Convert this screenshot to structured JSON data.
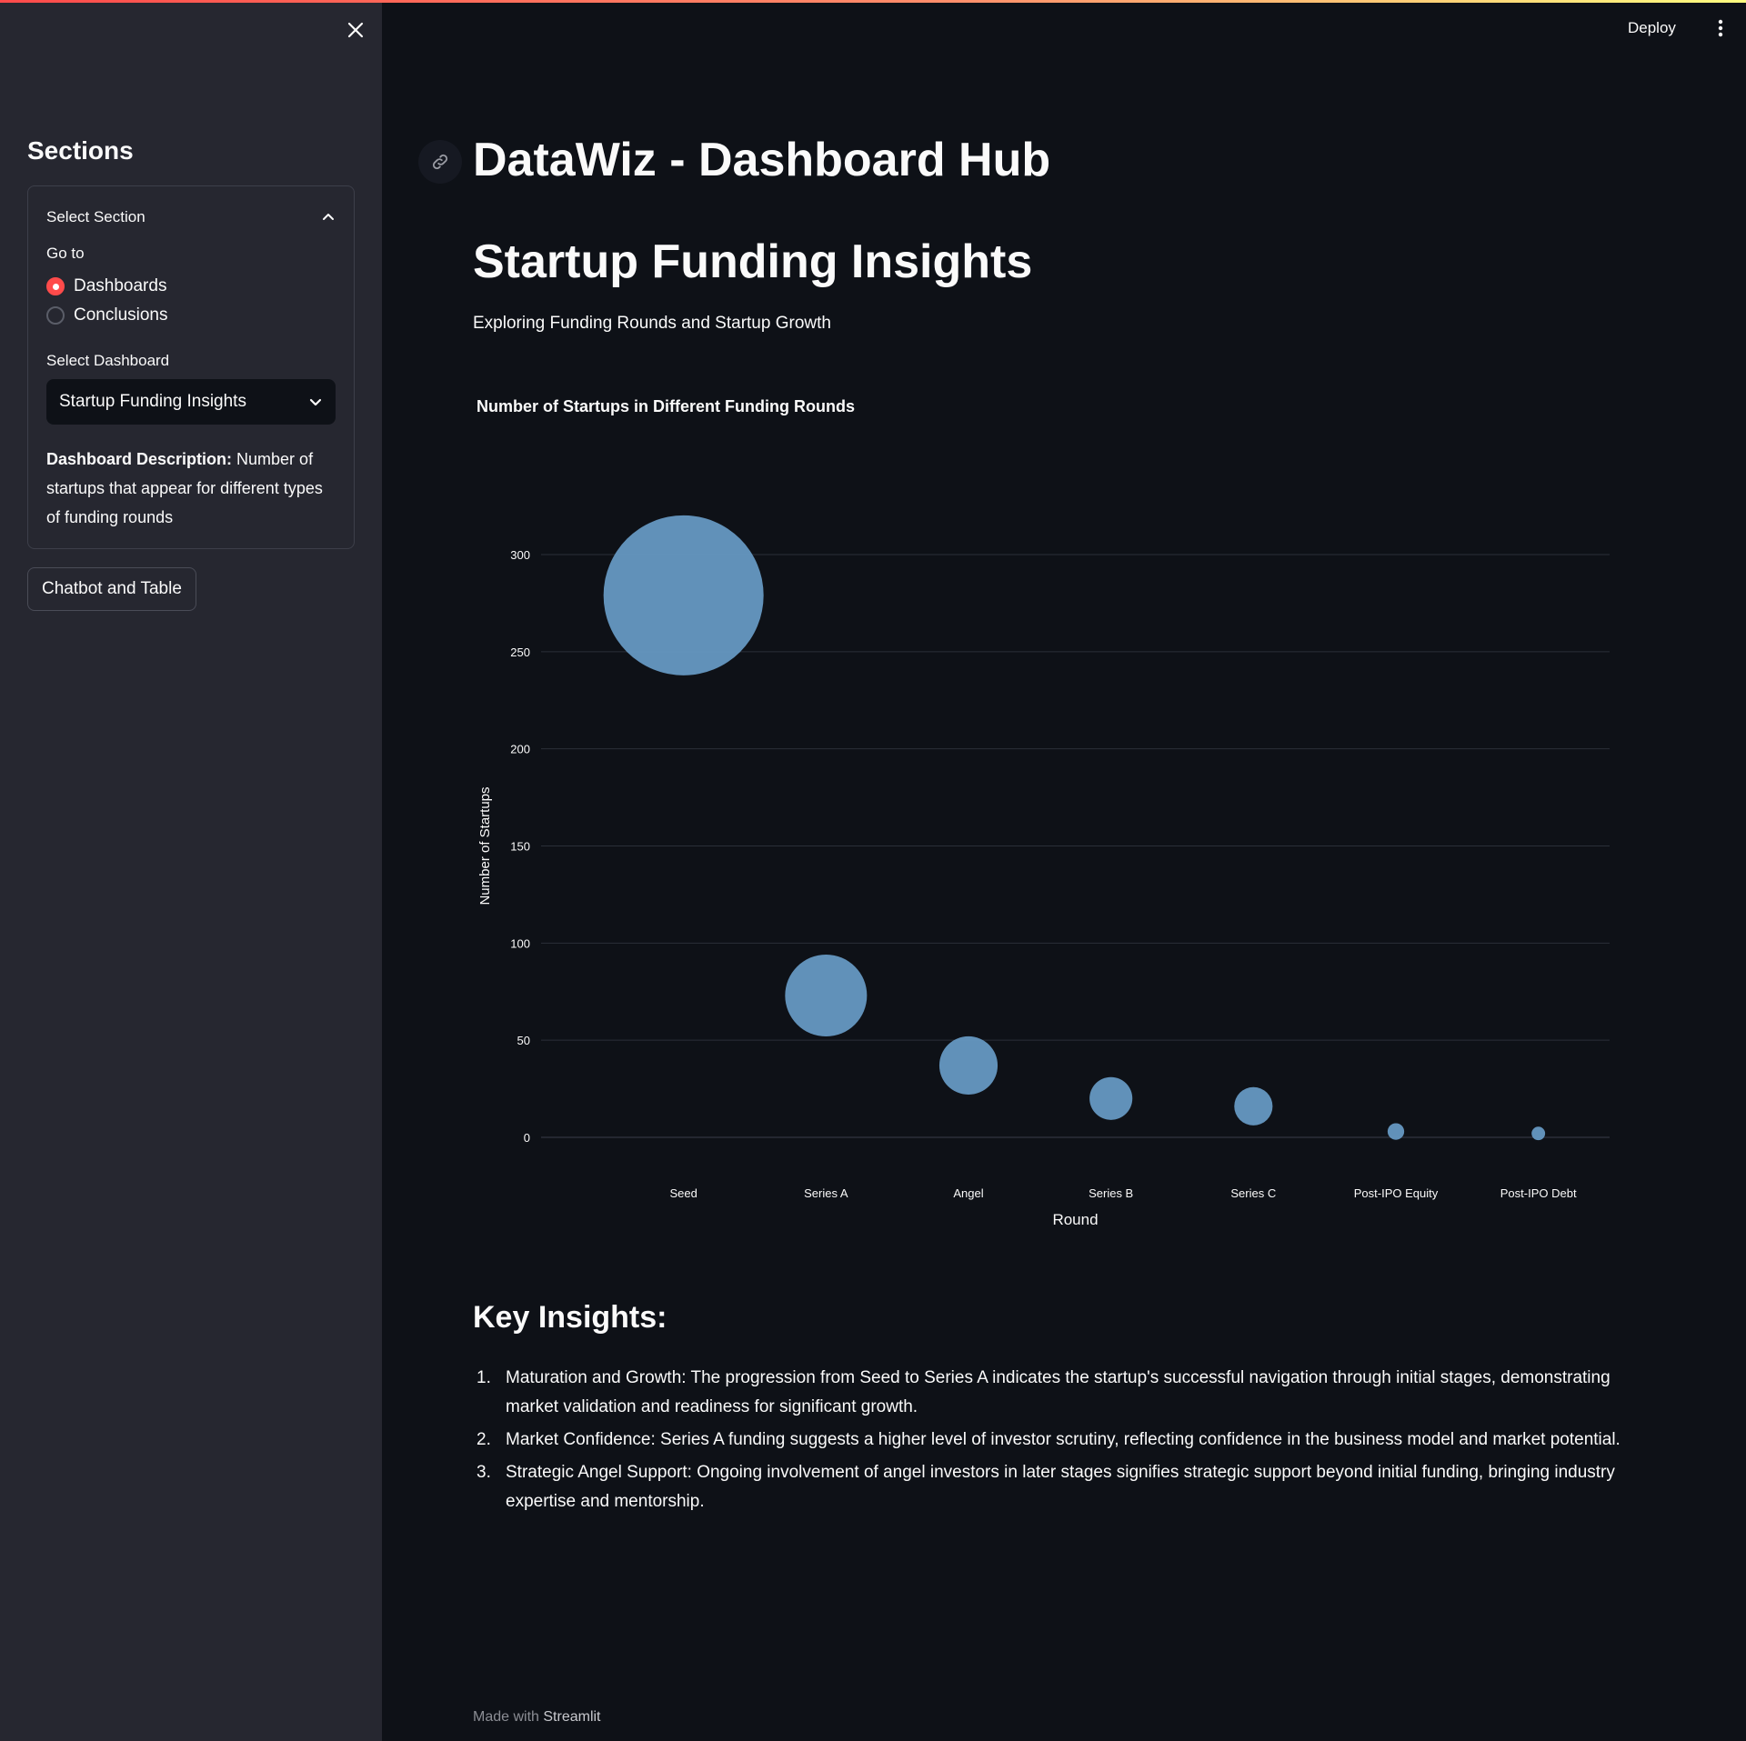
{
  "sidebar": {
    "title": "Sections",
    "expander_label": "Select Section",
    "goto_label": "Go to",
    "radio_options": [
      {
        "label": "Dashboards",
        "checked": true
      },
      {
        "label": "Conclusions",
        "checked": false
      }
    ],
    "select_label": "Select Dashboard",
    "select_value": "Startup Funding Insights",
    "description_bold": "Dashboard Description:",
    "description_text": " Number of startups that appear for different types of funding rounds",
    "chatbot_button": "Chatbot and Table"
  },
  "header": {
    "deploy_label": "Deploy"
  },
  "main": {
    "title": "DataWiz - Dashboard Hub",
    "subtitle": "Startup Funding Insights",
    "tagline": "Exploring Funding Rounds and Startup Growth",
    "insights_heading": "Key Insights:",
    "insights": [
      {
        "num": "1.",
        "text": "Maturation and Growth: The progression from Seed to Series A indicates the startup's successful navigation through initial stages, demonstrating market validation and readiness for significant growth."
      },
      {
        "num": "2.",
        "text": "Market Confidence: Series A funding suggests a higher level of investor scrutiny, reflecting confidence in the business model and market potential."
      },
      {
        "num": "3.",
        "text": "Strategic Angel Support: Ongoing involvement of angel investors in later stages signifies strategic support beyond initial funding, bringing industry expertise and mentorship."
      }
    ]
  },
  "footer": {
    "prefix": "Made with ",
    "brand": "Streamlit"
  },
  "colors": {
    "accent": "#ff4b4b",
    "bubble": "#6699c2",
    "background": "#0e1117",
    "sidebar_bg": "#262730"
  },
  "chart_data": {
    "type": "scatter",
    "title": "Number of Startups in Different Funding Rounds",
    "xlabel": "Round",
    "ylabel": "Number of Startups",
    "categories": [
      "Seed",
      "Series A",
      "Angel",
      "Series B",
      "Series C",
      "Post-IPO Equity",
      "Post-IPO Debt"
    ],
    "values": [
      279,
      73,
      37,
      20,
      16,
      3,
      2
    ],
    "y_ticks": [
      0,
      50,
      100,
      150,
      200,
      250,
      300
    ],
    "ylim": [
      0,
      300
    ],
    "grid": true,
    "bubble_size_by_value": true
  }
}
